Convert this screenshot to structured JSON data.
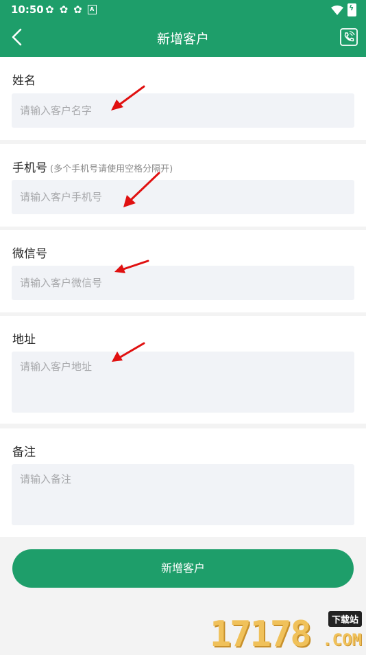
{
  "status_bar": {
    "time": "10:50"
  },
  "app_bar": {
    "title": "新增客户"
  },
  "form": {
    "name": {
      "label": "姓名",
      "placeholder": "请输入客户名字"
    },
    "phone": {
      "label": "手机号",
      "hint": "(多个手机号请使用空格分隔开)",
      "placeholder": "请输入客户手机号"
    },
    "wechat": {
      "label": "微信号",
      "placeholder": "请输入客户微信号"
    },
    "address": {
      "label": "地址",
      "placeholder": "请输入客户地址"
    },
    "remark": {
      "label": "备注",
      "placeholder": "请输入备注"
    }
  },
  "submit_label": "新增客户",
  "watermark": {
    "digits": "17178",
    "badge": "下载站",
    "suffix": ".COM"
  },
  "colors": {
    "primary": "#1e9e6a",
    "field_bg": "#f1f3f7",
    "page_bg": "#f3f3f3",
    "annotation_arrow": "#e01010"
  }
}
